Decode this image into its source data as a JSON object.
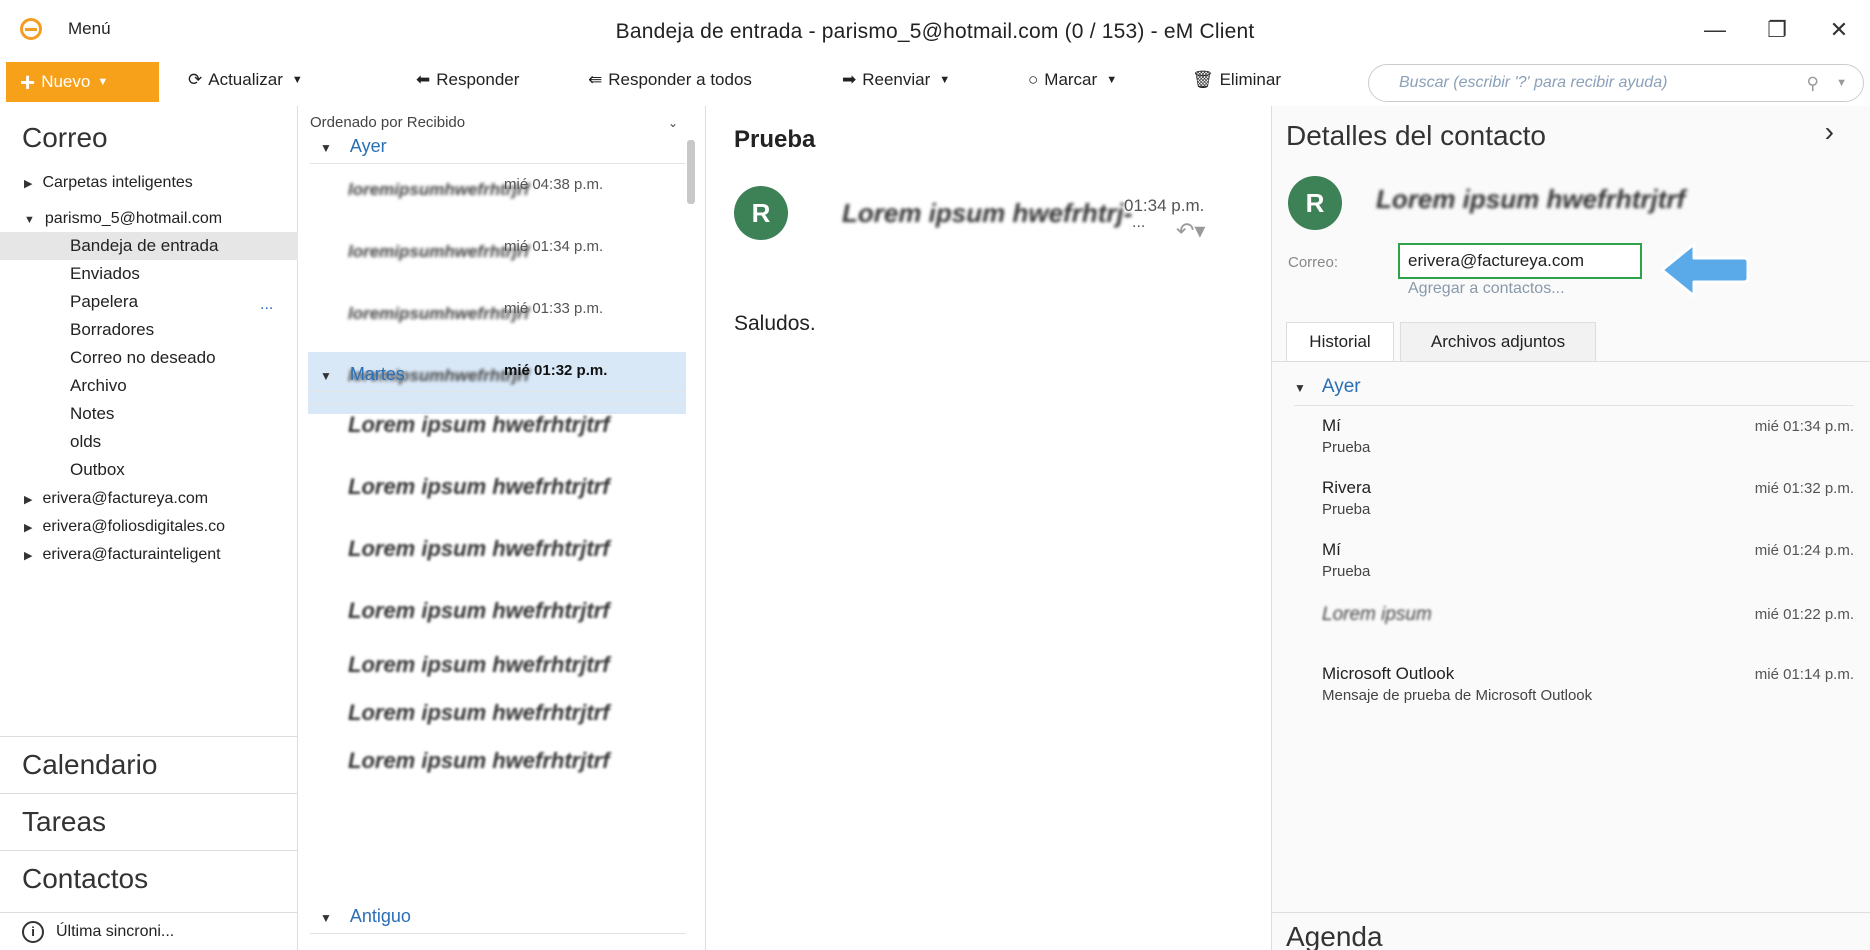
{
  "window": {
    "menu_label": "Menú",
    "title": "Bandeja de entrada - parismo_5@hotmail.com (0 / 153) - eM Client",
    "minimize": "—",
    "restore": "❐",
    "close": "✕"
  },
  "toolbar": {
    "new_label": "Nuevo",
    "refresh_label": "Actualizar",
    "reply_label": "Responder",
    "reply_all_label": "Responder a todos",
    "forward_label": "Reenviar",
    "mark_label": "Marcar",
    "delete_label": "Eliminar",
    "search_placeholder": "Buscar (escribir '?' para recibir ayuda)"
  },
  "sidebar": {
    "mail_title": "Correo",
    "smart_folders": "Carpetas inteligentes",
    "account_main": "parismo_5@hotmail.com",
    "folders": [
      "Bandeja de entrada",
      "Enviados",
      "Papelera",
      "Borradores",
      "Correo no deseado",
      "Archivo",
      "Notes",
      "olds",
      "Outbox"
    ],
    "papelera_more": "...",
    "other_accounts": [
      "erivera@factureya.com",
      "erivera@foliosdigitales.co",
      "erivera@facturainteligent"
    ],
    "nav": [
      "Calendario",
      "Tareas",
      "Contactos"
    ],
    "sync_status": "Última sincroni..."
  },
  "message_list": {
    "sort_label": "Ordenado por Recibido",
    "groups": [
      "Ayer",
      "Martes",
      "Antiguo"
    ],
    "yesterday": [
      {
        "sender": "loremipsumhwefrhtrjrf",
        "time": "mié 04:38 p.m."
      },
      {
        "sender": "loremipsumhwefrhtrjrf",
        "time": "mié 01:34 p.m."
      },
      {
        "sender": "loremipsumhwefrhtrjrf",
        "time": "mié 01:33 p.m."
      },
      {
        "sender": "loremipsumhwefrhtrjrf",
        "time": "mié 01:32 p.m."
      }
    ],
    "tuesday": [
      "Lorem ipsum hwefrhtrjtrf",
      "Lorem ipsum hwefrhtrjtrf",
      "Lorem ipsum hwefrhtrjtrf",
      "Lorem ipsum hwefrhtrjtrf",
      "Lorem ipsum hwefrhtrjtrf",
      "Lorem ipsum hwefrhtrjtrf",
      "Lorem ipsum hwefrhtrjtrf"
    ]
  },
  "reading": {
    "subject": "Prueba",
    "avatar_letter": "R",
    "sender": "Lorem ipsum hwefrhtrj-",
    "time": "01:34 p.m.",
    "more": "...",
    "body": "Saludos."
  },
  "contact": {
    "title": "Detalles del contacto",
    "avatar_letter": "R",
    "name": "Lorem ipsum hwefrhtrjtrf",
    "email_label": "Correo:",
    "email": "erivera@factureya.com",
    "add_to_contacts": "Agregar a contactos...",
    "tabs": [
      "Historial",
      "Archivos adjuntos"
    ],
    "history_group": "Ayer",
    "history": [
      {
        "name": "Mí",
        "subject": "Prueba",
        "time": "mié 01:34 p.m."
      },
      {
        "name": "Rivera",
        "subject": "Prueba",
        "time": "mié 01:32 p.m."
      },
      {
        "name": "Mí",
        "subject": "Prueba",
        "time": "mié 01:24 p.m."
      },
      {
        "name": "Lorem ipsum",
        "subject": "",
        "time": "mié 01:22 p.m."
      },
      {
        "name": "Microsoft Outlook",
        "subject": "Mensaje de prueba de Microsoft Outlook",
        "time": "mié 01:14 p.m."
      }
    ],
    "agenda_title": "Agenda"
  },
  "colors": {
    "accent_orange": "#f7a11a",
    "link_blue": "#2a6fb5",
    "avatar_green": "#3d8157",
    "highlight_green": "#2fa34a",
    "arrow_blue": "#5aa9e8"
  }
}
